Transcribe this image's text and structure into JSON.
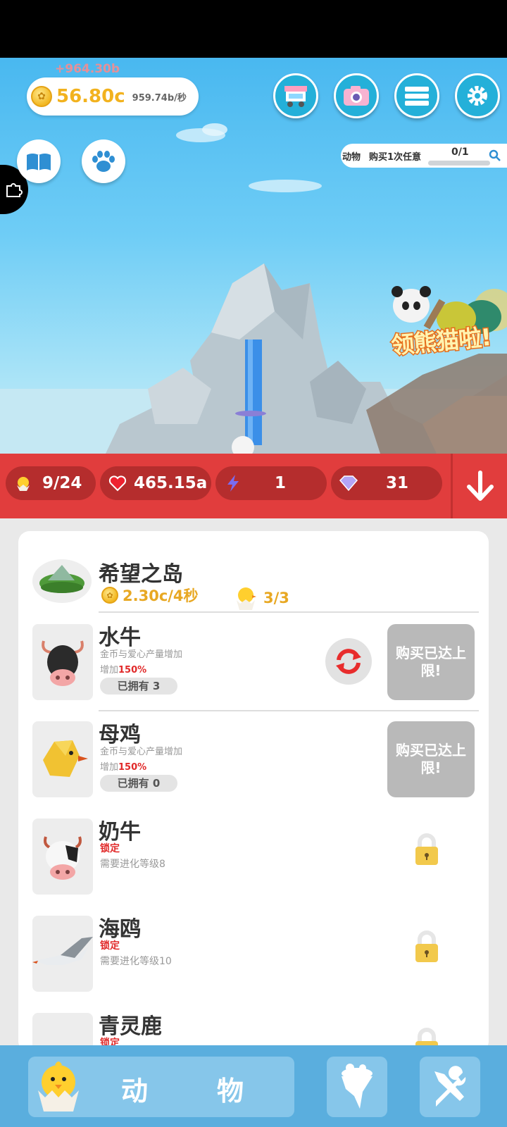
{
  "hud": {
    "coin_amount": "56.80c",
    "coin_rate": "959.74b/秒",
    "coin_float": "+964.30b",
    "top_buttons": [
      "shop-cart-icon",
      "camera-icon",
      "menu-icon",
      "gear-icon"
    ],
    "left_buttons": [
      "book-icon",
      "paw-icon"
    ]
  },
  "quest": {
    "text_a": "动物",
    "text_b": "购买1次任意",
    "progress": "0/1"
  },
  "banner": {
    "text": "领熊猫啦!"
  },
  "stats": {
    "chicks": "9/24",
    "hearts": "465.15a",
    "energy": "1",
    "gems": "31"
  },
  "island": {
    "name": "希望之岛",
    "rate": "2.30c/4秒",
    "count": "3/3"
  },
  "animals": [
    {
      "name": "水牛",
      "desc": "金币与爱心产量增加",
      "bonus_prefix": "增加",
      "bonus_value": "150%",
      "owned": "已拥有 3",
      "button": "购买已达上限!"
    },
    {
      "name": "母鸡",
      "desc": "金币与爱心产量增加",
      "bonus_prefix": "增加",
      "bonus_value": "150%",
      "owned": "已拥有 0",
      "button": "购买已达上限!"
    },
    {
      "name": "奶牛",
      "locked": "锁定",
      "req": "需要进化等级8"
    },
    {
      "name": "海鸥",
      "locked": "锁定",
      "req": "需要进化等级10"
    },
    {
      "name": "青灵鹿",
      "locked": "锁定"
    }
  ],
  "nav": {
    "animals_char1": "动",
    "animals_char2": "物"
  },
  "colors": {
    "stats_bar": "#e13d3d",
    "accent_gold": "#e8a823",
    "locked_red": "#e12a2a",
    "nav_bg": "#5aaede"
  }
}
